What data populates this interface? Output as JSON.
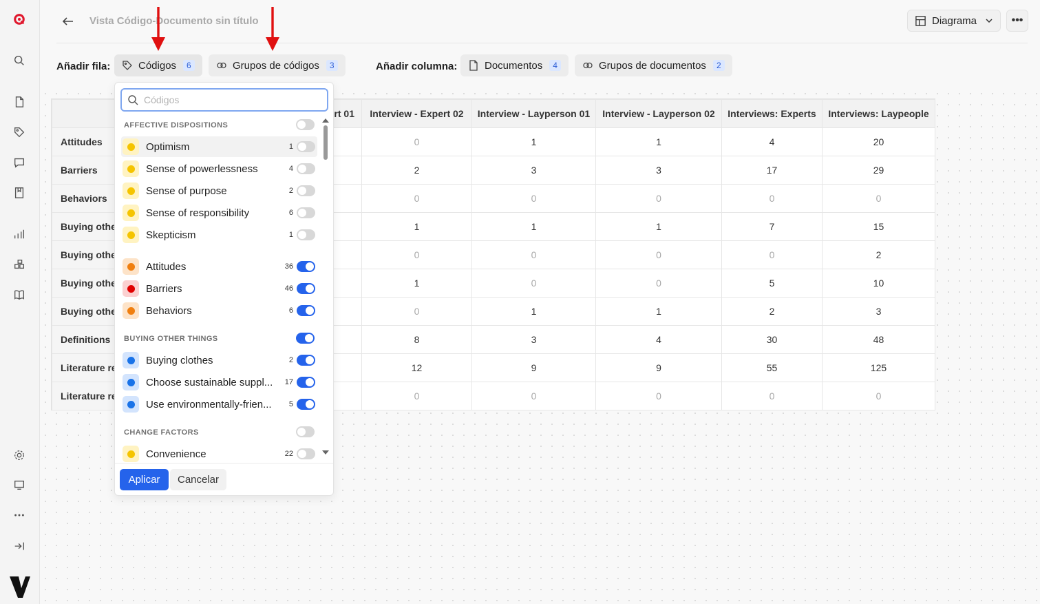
{
  "header": {
    "title": "Vista Código-Documento sin título",
    "view_button": "Diagrama",
    "more": "•••"
  },
  "toolbar": {
    "add_row_label": "Añadir fila:",
    "add_col_label": "Añadir columna:",
    "chips": [
      {
        "label": "Códigos",
        "count": "6"
      },
      {
        "label": "Grupos de códigos",
        "count": "3"
      },
      {
        "label": "Documentos",
        "count": "4"
      },
      {
        "label": "Grupos de documentos",
        "count": "2"
      }
    ]
  },
  "table": {
    "columns": [
      "",
      "rt 01",
      "Interview - Expert 02",
      "Interview - Layperson 01",
      "Interview - Layperson 02",
      "Interviews: Experts",
      "Interviews: Laypeople"
    ],
    "rows": [
      {
        "label": "Attitudes",
        "values": [
          "",
          "0",
          "1",
          "1",
          "4",
          "20"
        ]
      },
      {
        "label": "Barriers",
        "values": [
          "",
          "2",
          "3",
          "3",
          "17",
          "29"
        ]
      },
      {
        "label": "Behaviors",
        "values": [
          "",
          "0",
          "0",
          "0",
          "0",
          "0"
        ]
      },
      {
        "label": "Buying other",
        "values": [
          "",
          "1",
          "1",
          "1",
          "7",
          "15"
        ]
      },
      {
        "label": "Buying other",
        "values": [
          "",
          "0",
          "0",
          "0",
          "0",
          "2"
        ]
      },
      {
        "label": "Buying other",
        "values": [
          "",
          "1",
          "0",
          "0",
          "5",
          "10"
        ]
      },
      {
        "label": "Buying other",
        "values": [
          "",
          "0",
          "1",
          "1",
          "2",
          "3"
        ]
      },
      {
        "label": "Definitions",
        "values": [
          "",
          "8",
          "3",
          "4",
          "30",
          "48"
        ]
      },
      {
        "label": "Literature re",
        "values": [
          "",
          "12",
          "9",
          "9",
          "55",
          "125"
        ]
      },
      {
        "label": "Literature re",
        "values": [
          "",
          "0",
          "0",
          "0",
          "0",
          "0"
        ]
      }
    ]
  },
  "dropdown": {
    "search_placeholder": "Códigos",
    "groups": [
      {
        "title": "AFFECTIVE DISPOSITIONS",
        "enabled": false
      },
      {
        "title": "BUYING OTHER THINGS",
        "enabled": true
      },
      {
        "title": "CHANGE FACTORS",
        "enabled": false
      }
    ],
    "items": [
      {
        "label": "Optimism",
        "count": "1",
        "color": "#f5c400",
        "bg": "#fff3c2",
        "on": false
      },
      {
        "label": "Sense of powerlessness",
        "count": "4",
        "color": "#f5c400",
        "bg": "#fff3c2",
        "on": false
      },
      {
        "label": "Sense of purpose",
        "count": "2",
        "color": "#f5c400",
        "bg": "#fff3c2",
        "on": false
      },
      {
        "label": "Sense of responsibility",
        "count": "6",
        "color": "#f5c400",
        "bg": "#fff3c2",
        "on": false
      },
      {
        "label": "Skepticism",
        "count": "1",
        "color": "#f5c400",
        "bg": "#fff3c2",
        "on": false
      },
      {
        "label": "Attitudes",
        "count": "36",
        "color": "#f07f10",
        "bg": "#fde3c8",
        "on": true
      },
      {
        "label": "Barriers",
        "count": "46",
        "color": "#e00000",
        "bg": "#fbd0d0",
        "on": true
      },
      {
        "label": "Behaviors",
        "count": "6",
        "color": "#f07f10",
        "bg": "#fde3c8",
        "on": true
      },
      {
        "label": "Buying clothes",
        "count": "2",
        "color": "#1a73e8",
        "bg": "#d3e4fd",
        "on": true
      },
      {
        "label": "Choose sustainable suppl...",
        "count": "17",
        "color": "#1a73e8",
        "bg": "#d3e4fd",
        "on": true
      },
      {
        "label": "Use environmentally-frien...",
        "count": "5",
        "color": "#1a73e8",
        "bg": "#d3e4fd",
        "on": true
      },
      {
        "label": "Convenience",
        "count": "22",
        "color": "#f5c400",
        "bg": "#fff3c2",
        "on": false
      }
    ],
    "apply": "Aplicar",
    "cancel": "Cancelar"
  },
  "colors": {
    "accent": "#2563eb",
    "arrow": "#e01010"
  }
}
